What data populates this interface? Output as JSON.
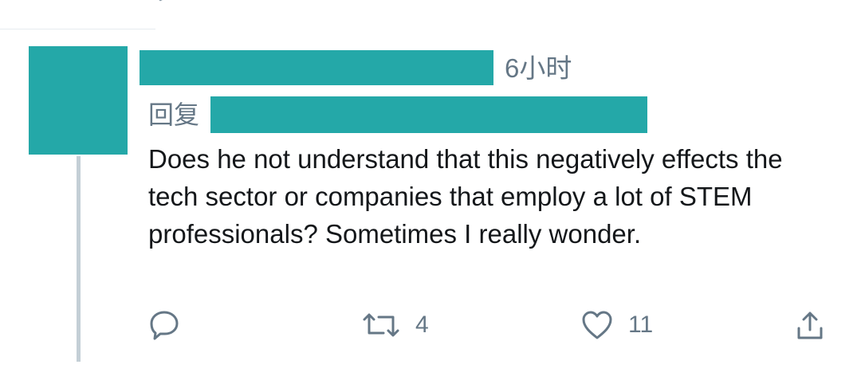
{
  "tweet": {
    "timestamp": "6小时",
    "reply_prefix": "回复",
    "text": "Does he not understand that this negatively effects the tech sector or companies that employ a lot of STEM professionals? Sometimes I really wonder.",
    "name_redaction_color": "#24a8a8",
    "avatar_color": "#24a8a8"
  },
  "actions": {
    "reply_icon": "reply-icon",
    "retweet_icon": "retweet-icon",
    "retweet_count": "4",
    "like_icon": "heart-icon",
    "like_count": "11",
    "share_icon": "share-icon"
  },
  "colors": {
    "text_primary": "#14171a",
    "text_secondary": "#657786",
    "thread_line": "#c4cfd6",
    "redaction": "#24a8a8"
  }
}
